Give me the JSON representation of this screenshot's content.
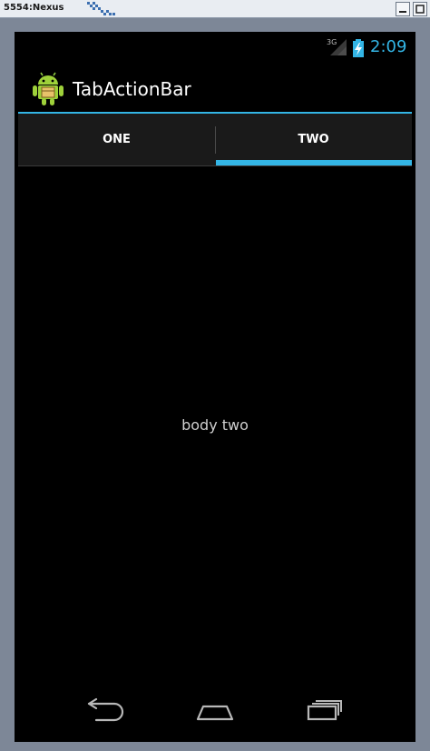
{
  "window": {
    "title": "5554:Nexus"
  },
  "status_bar": {
    "network": "3G",
    "time": "2:09",
    "accent": "#33b5e5"
  },
  "action_bar": {
    "title": "TabActionBar",
    "icon": "android-icon"
  },
  "tabs": [
    {
      "label": "ONE",
      "selected": false
    },
    {
      "label": "TWO",
      "selected": true
    }
  ],
  "body": {
    "text": "body two"
  },
  "nav_bar": {
    "buttons": [
      "back-icon",
      "home-icon",
      "recent-apps-icon"
    ]
  },
  "colors": {
    "accent": "#33b5e5",
    "background": "#000000",
    "tab_bar": "#1a1a1a"
  }
}
